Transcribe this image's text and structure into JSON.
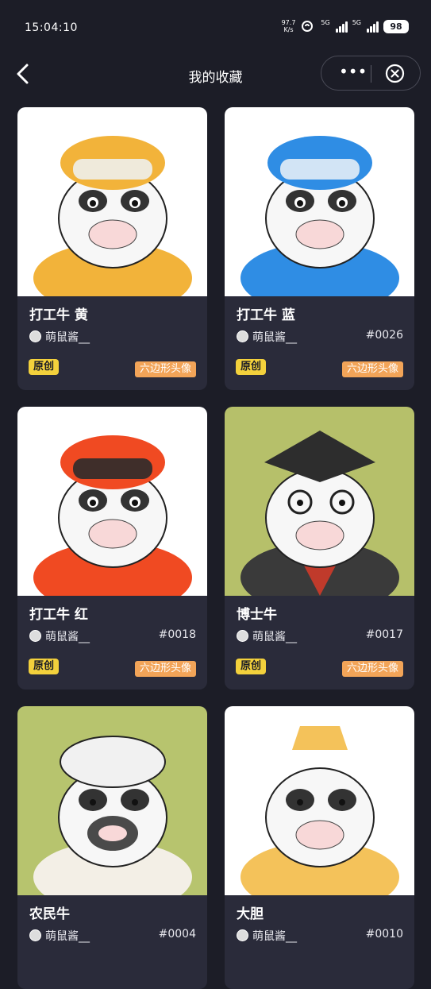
{
  "status_bar": {
    "time": "15:04:10",
    "net_speed_value": "97.7",
    "net_speed_unit": "K/s",
    "sim1_label": "5G",
    "sim2_label": "5G",
    "battery": "98"
  },
  "header": {
    "title": "我的收藏",
    "more_label": "•••"
  },
  "cards": [
    {
      "name": "打工牛 黄",
      "author": "萌鼠酱__",
      "serial": "",
      "badge_original": "原创",
      "badge_type": "六边形头像",
      "bg": "#ffffff",
      "accent": "#f2b33a"
    },
    {
      "name": "打工牛 蓝",
      "author": "萌鼠酱__",
      "serial": "#0026",
      "badge_original": "原创",
      "badge_type": "六边形头像",
      "bg": "#ffffff",
      "accent": "#2f8de4"
    },
    {
      "name": "打工牛 红",
      "author": "萌鼠酱__",
      "serial": "#0018",
      "badge_original": "原创",
      "badge_type": "六边形头像",
      "bg": "#ffffff",
      "accent": "#f04a22"
    },
    {
      "name": "博士牛",
      "author": "萌鼠酱__",
      "serial": "#0017",
      "badge_original": "原创",
      "badge_type": "六边形头像",
      "bg": "#b6c06a",
      "accent": "#3a3a3a"
    },
    {
      "name": "农民牛",
      "author": "萌鼠酱__",
      "serial": "#0004",
      "badge_original": "",
      "badge_type": "",
      "bg": "#b7c46e",
      "accent": "#f3efe6"
    },
    {
      "name": "大胆",
      "author": "萌鼠酱__",
      "serial": "#0010",
      "badge_original": "",
      "badge_type": "",
      "bg": "#ffffff",
      "accent": "#f4c25a"
    }
  ]
}
